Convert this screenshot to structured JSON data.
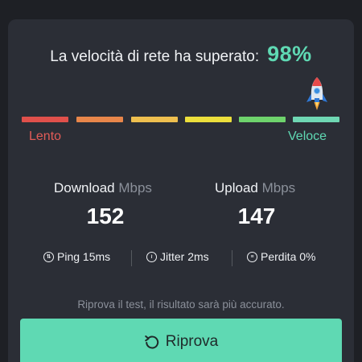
{
  "result": {
    "headline_label": "La velocità di rete ha superato:",
    "percentile": "98%"
  },
  "speed_scale": {
    "left_label": "Lento",
    "right_label": "Veloce",
    "segment_colors": [
      "#e0504b",
      "#e8864a",
      "#eebf4f",
      "#ecdf3c",
      "#6ed36c",
      "#6fd7b3"
    ],
    "level": 0.98,
    "indicator_icon": "rocket-icon"
  },
  "download": {
    "label": "Download",
    "unit": "Mbps",
    "value": "152"
  },
  "upload": {
    "label": "Upload",
    "unit": "Mbps",
    "value": "147"
  },
  "stats": {
    "ping": "Ping 15ms",
    "jitter": "Jitter 2ms",
    "loss": "Perdita 0%"
  },
  "hint_text": "Riprova il test, il risultato sarà più accurato.",
  "retry_button": {
    "label": "Riprova",
    "icon": "refresh-icon"
  },
  "colors": {
    "accent": "#5fd9b3",
    "card": "#2b2e36",
    "background": "#1e2025"
  }
}
